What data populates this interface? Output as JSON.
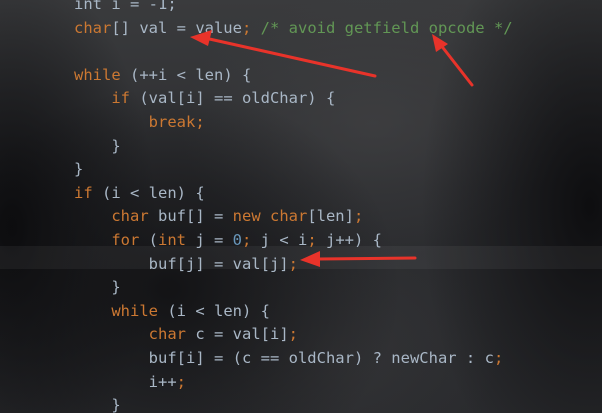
{
  "editor": {
    "lines": [
      [
        {
          "t": "int i = -1;",
          "c": "tx"
        }
      ],
      [
        {
          "t": "char",
          "c": "kw"
        },
        {
          "t": "[] val = value",
          "c": "tx"
        },
        {
          "t": "; ",
          "c": "kw"
        },
        {
          "t": "/* avoid getfield opcode */",
          "c": "cm"
        }
      ],
      [],
      [
        {
          "t": "while ",
          "c": "kw"
        },
        {
          "t": "(++i < len) {",
          "c": "tx"
        }
      ],
      [
        {
          "t": "    "
        },
        {
          "t": "if ",
          "c": "kw"
        },
        {
          "t": "(val[i] == oldChar) {",
          "c": "tx"
        }
      ],
      [
        {
          "t": "        "
        },
        {
          "t": "break;",
          "c": "kw"
        }
      ],
      [
        {
          "t": "    }",
          "c": "tx"
        }
      ],
      [
        {
          "t": "}",
          "c": "tx"
        }
      ],
      [
        {
          "t": "if ",
          "c": "kw"
        },
        {
          "t": "(i < len) {",
          "c": "tx"
        }
      ],
      [
        {
          "t": "    "
        },
        {
          "t": "char ",
          "c": "kw"
        },
        {
          "t": "buf[] = ",
          "c": "tx"
        },
        {
          "t": "new char",
          "c": "kw"
        },
        {
          "t": "[len]",
          "c": "tx"
        },
        {
          "t": ";",
          "c": "kw"
        }
      ],
      [
        {
          "t": "    "
        },
        {
          "t": "for ",
          "c": "kw"
        },
        {
          "t": "(",
          "c": "tx"
        },
        {
          "t": "int ",
          "c": "kw"
        },
        {
          "t": "j = ",
          "c": "tx"
        },
        {
          "t": "0",
          "c": "nm"
        },
        {
          "t": "; ",
          "c": "kw"
        },
        {
          "t": "j < i",
          "c": "tx"
        },
        {
          "t": "; ",
          "c": "kw"
        },
        {
          "t": "j++) {",
          "c": "tx"
        }
      ],
      [
        {
          "t": "        buf[j] = val[j]",
          "c": "tx"
        },
        {
          "t": ";",
          "c": "kw"
        }
      ],
      [
        {
          "t": "    }",
          "c": "tx"
        }
      ],
      [
        {
          "t": "    "
        },
        {
          "t": "while ",
          "c": "kw"
        },
        {
          "t": "(i < len) {",
          "c": "tx"
        }
      ],
      [
        {
          "t": "        "
        },
        {
          "t": "char ",
          "c": "kw"
        },
        {
          "t": "c = val[i]",
          "c": "tx"
        },
        {
          "t": ";",
          "c": "kw"
        }
      ],
      [
        {
          "t": "        buf[i] = (c == oldChar) ? newChar : c",
          "c": "tx"
        },
        {
          "t": ";",
          "c": "kw"
        }
      ],
      [
        {
          "t": "        i++",
          "c": "tx"
        },
        {
          "t": ";",
          "c": "kw"
        }
      ],
      [
        {
          "t": "    }",
          "c": "tx"
        }
      ]
    ],
    "highlighted_line": 11
  },
  "colors": {
    "keyword": "#cc7832",
    "comment": "#629755",
    "number": "#6897bb",
    "text": "#a9b7c6",
    "arrow": "#e8332a"
  },
  "annotations": {
    "arrows": 3,
    "arrow_targets": [
      "val",
      "avoid getfield opcode",
      "val[j]"
    ]
  }
}
